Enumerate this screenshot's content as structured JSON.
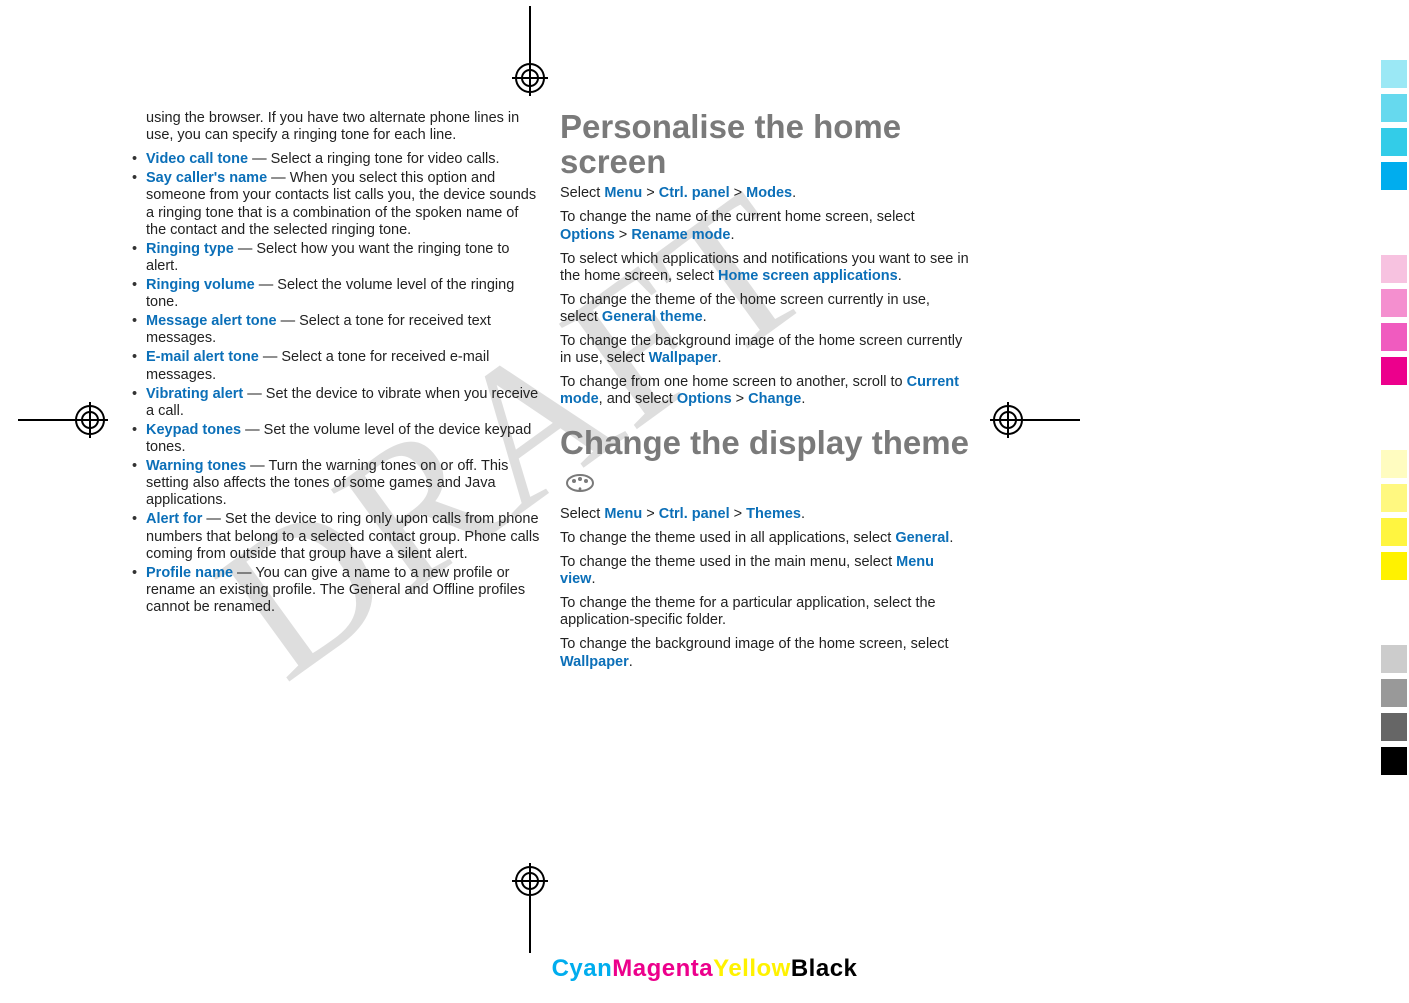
{
  "watermark": "DRAFT",
  "left_col": {
    "intro": "using the browser. If you have two alternate phone lines in use, you can specify a ringing tone for each line.",
    "items": [
      {
        "term": "Video call tone",
        "desc": " — Select a ringing tone for video calls."
      },
      {
        "term": "Say caller's name",
        "desc": " — When you select this option and someone from your contacts list calls you, the device sounds a ringing tone that is a combination of the spoken name of the contact and the selected ringing tone."
      },
      {
        "term": "Ringing type",
        "desc": " — Select how you want the ringing tone to alert."
      },
      {
        "term": "Ringing volume",
        "desc": " — Select the volume level of the ringing tone."
      },
      {
        "term": "Message alert tone",
        "desc": " — Select a tone for received text messages."
      },
      {
        "term": "E-mail alert tone",
        "desc": " — Select a tone for received e-mail messages."
      },
      {
        "term": "Vibrating alert",
        "desc": " — Set the device to vibrate when you receive a call."
      },
      {
        "term": "Keypad tones",
        "desc": " — Set the volume level of the device keypad tones."
      },
      {
        "term": "Warning tones",
        "desc": " — Turn the warning tones on or off. This setting also affects the tones of some games and Java applications."
      },
      {
        "term": "Alert for",
        "desc": " — Set the device to ring only upon calls from phone numbers that belong to a selected contact group. Phone calls coming from outside that group have a silent alert."
      },
      {
        "term": "Profile name",
        "desc": " — You can give a name to a new profile or rename an existing profile. The General and Offline profiles cannot be renamed."
      }
    ]
  },
  "right_col": {
    "h1a": "Personalise the home screen",
    "p1_a": "Select ",
    "menu": "Menu",
    "gt": "  >  ",
    "ctrl": "Ctrl. panel",
    "modes": "Modes",
    "p2_a": "To change the name of the current home screen, select ",
    "options": "Options",
    "rename": "Rename mode",
    "p3_a": "To select which applications and notifications you want to see in the home screen, select ",
    "hsa": "Home screen applications",
    "p4_a": "To change the theme of the home screen currently in use, select ",
    "gtheme": "General theme",
    "p5_a": "To change the background image of the home screen currently in use, select ",
    "wallpaper": "Wallpaper",
    "p6_a": "To change from one home screen to another, scroll to ",
    "curmode": "Current mode",
    "p6_b": ", and select ",
    "change": "Change",
    "h1b": "Change the display theme",
    "p7_a": "Select ",
    "themes": "Themes",
    "p8_a": "To change the theme used in all applications, select ",
    "general": "General",
    "p9_a": "To change the theme used in the main menu, select ",
    "menuview": "Menu view",
    "p10_a": "To change the theme for a particular application, select the application-specific folder.",
    "p11_a": "To change the background image of the home screen, select "
  },
  "cmyk": {
    "c": "Cyan",
    "m": "Magenta",
    "y": "Yellow",
    "k": "Black"
  },
  "colorbar_swatches": [
    "#9be8f5",
    "#66d9ee",
    "#33cce8",
    "#00adee",
    "spacer",
    "#f7c2e0",
    "#f48fcf",
    "#f05bbf",
    "#ec008c",
    "spacer",
    "#fffcc0",
    "#fff880",
    "#fff540",
    "#fff200",
    "spacer",
    "#cccccc",
    "#999999",
    "#666666",
    "#000000"
  ]
}
